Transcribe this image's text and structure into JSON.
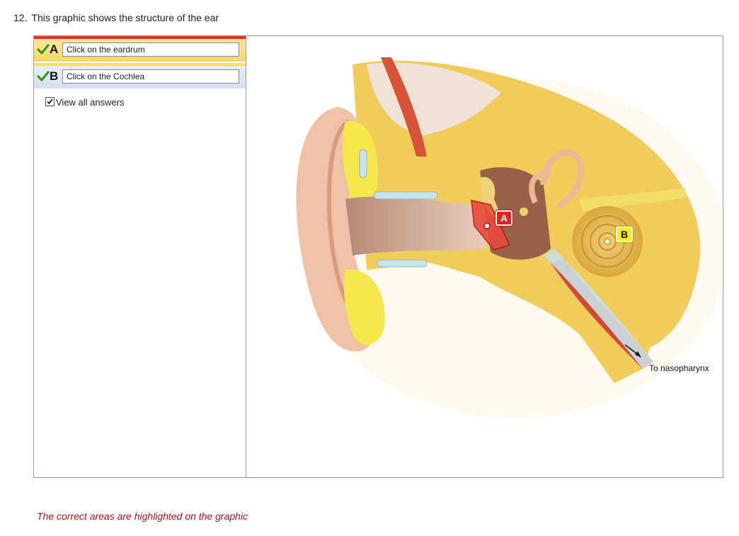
{
  "question": {
    "number": "12.",
    "text": "This graphic shows the structure of the ear"
  },
  "answers": [
    {
      "letter": "A",
      "field_value": "Click on the eardrum",
      "status_icon": "check-icon",
      "accent": "#e53319"
    },
    {
      "letter": "B",
      "field_value": "Click on the Cochlea",
      "status_icon": "check-icon",
      "accent": "#f5e44a"
    }
  ],
  "view_all": {
    "label": "View all answers",
    "checked": true
  },
  "graphic": {
    "markers": [
      {
        "label": "A",
        "color": "#e2231a"
      },
      {
        "label": "B",
        "color": "#f7ea1e"
      }
    ],
    "caption": "To nasopharynx"
  },
  "feedback": "The correct areas are highlighted on the graphic"
}
